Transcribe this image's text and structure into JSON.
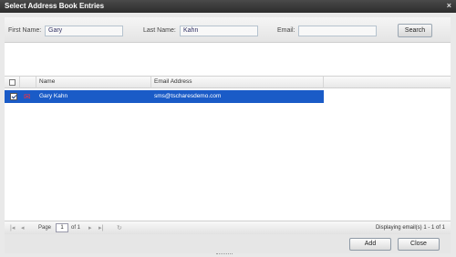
{
  "window": {
    "title": "Select Address Book Entries",
    "close_glyph": "×"
  },
  "search": {
    "first_name_label": "First Name:",
    "first_name_value": "Gary",
    "last_name_label": "Last Name:",
    "last_name_value": "Kahn",
    "email_label": "Email:",
    "email_value": "",
    "search_button": "Search"
  },
  "grid": {
    "columns": {
      "name": "Name",
      "email": "Email Address"
    },
    "rows": [
      {
        "name": "Gary Kahn",
        "email": "sms@tscharesdemo.com",
        "selected": true,
        "checked": true
      }
    ]
  },
  "pager": {
    "page_label": "Page",
    "page_value": "1",
    "of_label": "of 1",
    "status": "Displaying email(s) 1 - 1 of 1"
  },
  "footer": {
    "add_button": "Add",
    "close_button": "Close"
  },
  "icons": {
    "first": "first-page-icon",
    "prev": "prev-page-icon",
    "next": "next-page-icon",
    "last": "last-page-icon",
    "refresh": "refresh-icon",
    "contact": "contact-card-icon"
  },
  "colors": {
    "selection": "#1a5bc7",
    "titlebar": "#2c2c2c"
  }
}
